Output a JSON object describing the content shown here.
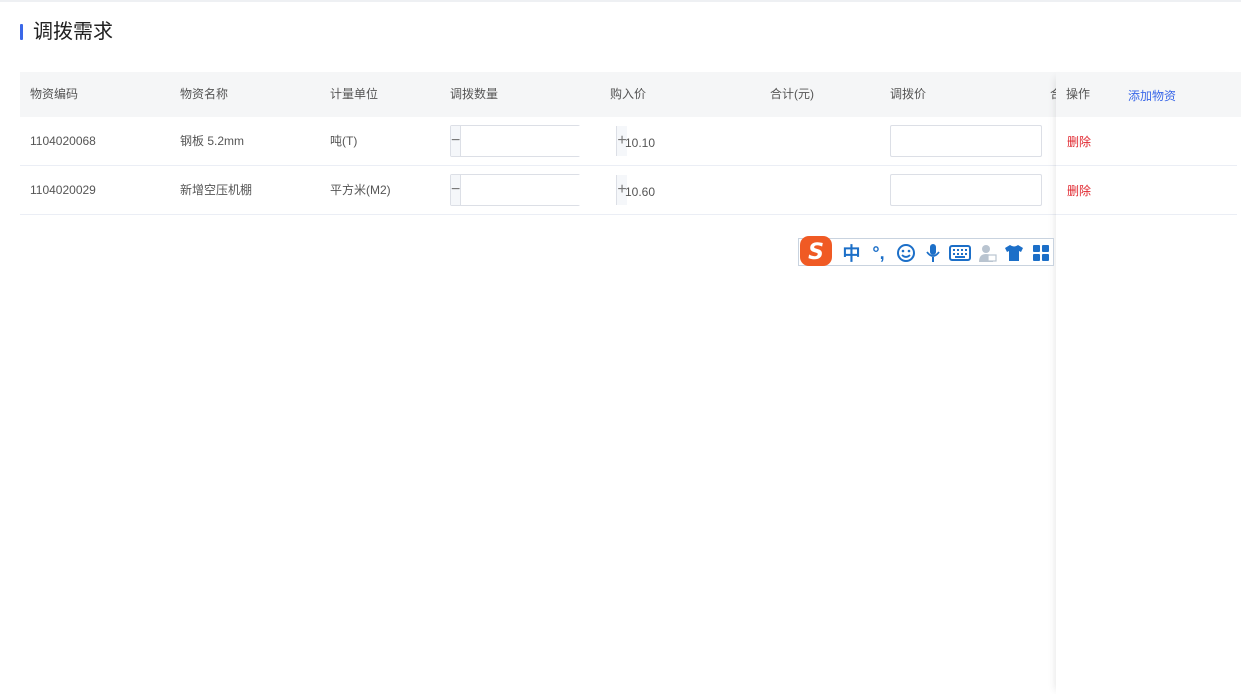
{
  "page": {
    "title": "调拨需求"
  },
  "table": {
    "headers": {
      "code": "物资编码",
      "name": "物资名称",
      "unit": "计量单位",
      "quantity": "调拨数量",
      "purchase_price": "购入价",
      "total": "合计(元)",
      "transfer_price": "调拨价",
      "truncated": "合"
    },
    "rows": [
      {
        "code": "1104020068",
        "name": "钢板 5.2mm",
        "unit": "吨(T)",
        "quantity": "",
        "purchase_price": "10.10",
        "total": "",
        "transfer_price": ""
      },
      {
        "code": "1104020029",
        "name": "新增空压机棚",
        "unit": "平方米(M2)",
        "quantity": "",
        "purchase_price": "10.60",
        "total": "",
        "transfer_price": ""
      }
    ],
    "stepper": {
      "minus": "−",
      "plus": "+"
    }
  },
  "fixed_column": {
    "header": "操作",
    "add_link": "添加物资",
    "delete_label": "删除"
  },
  "ime_toolbar": {
    "icons": [
      "sogou-logo-icon",
      "chinese-mode-icon",
      "punctuation-icon",
      "emoji-icon",
      "microphone-icon",
      "keyboard-icon",
      "user-icon",
      "skin-icon",
      "toolbox-icon"
    ],
    "mode_label": "中",
    "punct_label": "°,",
    "accent_color": "#1c6fc8",
    "logo_color": "#f05a24"
  },
  "colors": {
    "accent": "#3b68e8",
    "danger": "#e0262e",
    "header_bg": "#f5f6f7"
  }
}
